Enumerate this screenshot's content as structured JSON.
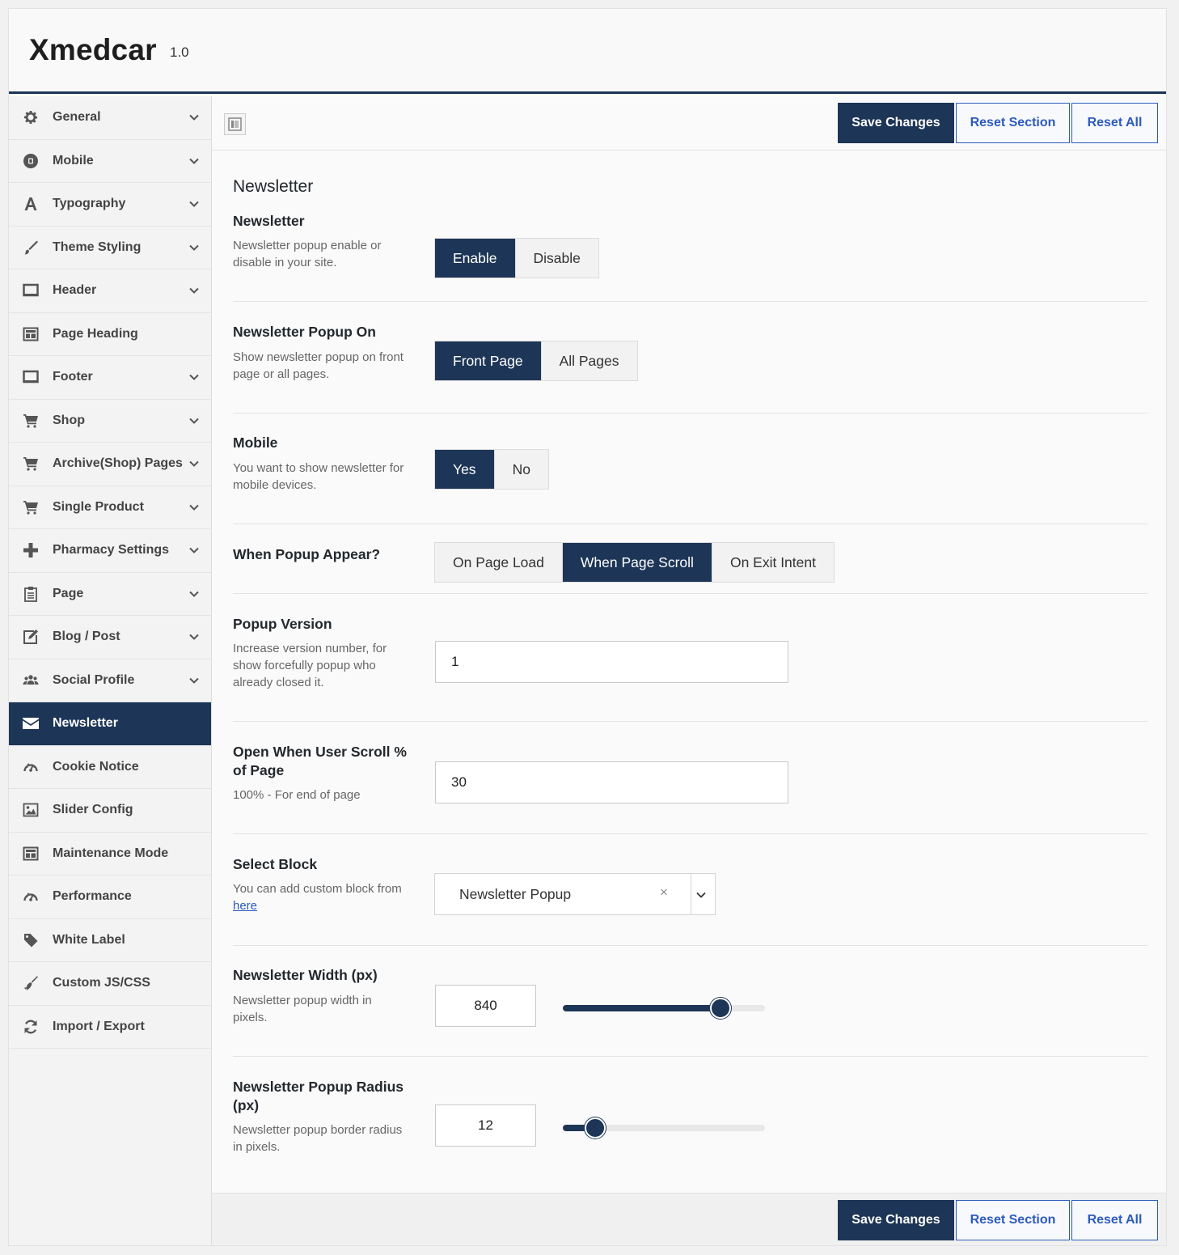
{
  "app": {
    "title": "Xmedcar",
    "version": "1.0"
  },
  "colors": {
    "accent": "#1d3557",
    "link": "#2c5bbf"
  },
  "sidebar": {
    "items": [
      {
        "label": "General",
        "icon": "gear-icon",
        "expandable": true,
        "active": false
      },
      {
        "label": "Mobile",
        "icon": "mobile-icon",
        "expandable": true,
        "active": false
      },
      {
        "label": "Typography",
        "icon": "font-icon",
        "expandable": true,
        "active": false
      },
      {
        "label": "Theme Styling",
        "icon": "brush-icon",
        "expandable": true,
        "active": false
      },
      {
        "label": "Header",
        "icon": "monitor-icon",
        "expandable": true,
        "active": false
      },
      {
        "label": "Page Heading",
        "icon": "window-icon",
        "expandable": false,
        "active": false
      },
      {
        "label": "Footer",
        "icon": "monitor-icon",
        "expandable": true,
        "active": false
      },
      {
        "label": "Shop",
        "icon": "cart-icon",
        "expandable": true,
        "active": false
      },
      {
        "label": "Archive(Shop) Pages",
        "icon": "cart-icon",
        "expandable": true,
        "active": false
      },
      {
        "label": "Single Product",
        "icon": "cart-icon",
        "expandable": true,
        "active": false
      },
      {
        "label": "Pharmacy Settings",
        "icon": "plus-icon",
        "expandable": true,
        "active": false
      },
      {
        "label": "Page",
        "icon": "clipboard-icon",
        "expandable": true,
        "active": false
      },
      {
        "label": "Blog / Post",
        "icon": "edit-icon",
        "expandable": true,
        "active": false
      },
      {
        "label": "Social Profile",
        "icon": "users-icon",
        "expandable": true,
        "active": false
      },
      {
        "label": "Newsletter",
        "icon": "envelope-icon",
        "expandable": false,
        "active": true
      },
      {
        "label": "Cookie Notice",
        "icon": "dashboard-icon",
        "expandable": false,
        "active": false
      },
      {
        "label": "Slider Config",
        "icon": "image-icon",
        "expandable": false,
        "active": false
      },
      {
        "label": "Maintenance Mode",
        "icon": "window-icon",
        "expandable": false,
        "active": false
      },
      {
        "label": "Performance",
        "icon": "dashboard-icon",
        "expandable": false,
        "active": false
      },
      {
        "label": "White Label",
        "icon": "tag-icon",
        "expandable": false,
        "active": false
      },
      {
        "label": "Custom JS/CSS",
        "icon": "broom-icon",
        "expandable": false,
        "active": false
      },
      {
        "label": "Import / Export",
        "icon": "refresh-icon",
        "expandable": false,
        "active": false
      }
    ]
  },
  "toolbar": {
    "save_label": "Save Changes",
    "reset_section_label": "Reset Section",
    "reset_all_label": "Reset All"
  },
  "section": {
    "title": "Newsletter",
    "fields": {
      "newsletter": {
        "title": "Newsletter",
        "desc": "Newsletter popup enable or disable in your site.",
        "options": [
          "Enable",
          "Disable"
        ],
        "selected": "Enable"
      },
      "popup_on": {
        "title": "Newsletter Popup On",
        "desc": "Show newsletter popup on front page or all pages.",
        "options": [
          "Front Page",
          "All Pages"
        ],
        "selected": "Front Page"
      },
      "mobile": {
        "title": "Mobile",
        "desc": "You want to show newsletter for mobile devices.",
        "options": [
          "Yes",
          "No"
        ],
        "selected": "Yes"
      },
      "appear": {
        "title": "When Popup Appear?",
        "options": [
          "On Page Load",
          "When Page Scroll",
          "On Exit Intent"
        ],
        "selected": "When Page Scroll"
      },
      "version": {
        "title": "Popup Version",
        "desc": "Increase version number, for show forcefully popup who already closed it.",
        "value": "1"
      },
      "scroll": {
        "title": "Open When User Scroll % of Page",
        "desc": "100% - For end of page",
        "value": "30"
      },
      "block": {
        "title": "Select Block",
        "desc_prefix": "You can add custom block from ",
        "desc_link": "here",
        "value": "Newsletter Popup",
        "clear": "×"
      },
      "width": {
        "title": "Newsletter Width (px)",
        "desc": "Newsletter popup width in pixels.",
        "value": "840",
        "level": 0.78
      },
      "radius": {
        "title": "Newsletter Popup Radius (px)",
        "desc": "Newsletter popup border radius in pixels.",
        "value": "12",
        "level": 0.16
      }
    }
  }
}
